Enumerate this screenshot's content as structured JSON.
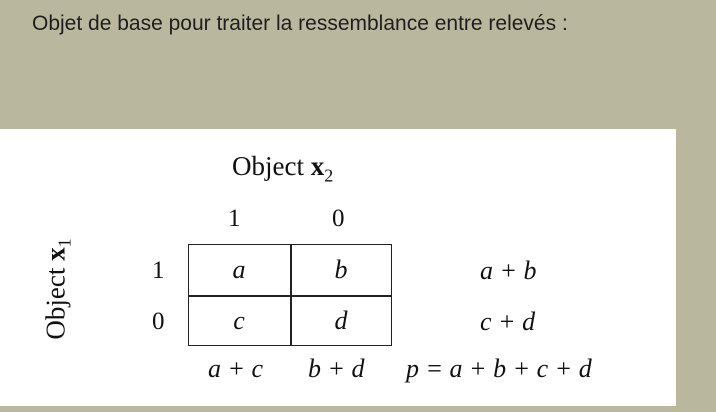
{
  "heading": "Objet de base pour traiter la ressemblance entre relevés :",
  "table": {
    "col_object": "Object ",
    "col_var": "x",
    "col_sub": "2",
    "row_object": "Object ",
    "row_var": "x",
    "row_sub": "1",
    "col_labels": [
      "1",
      "0"
    ],
    "row_labels": [
      "1",
      "0"
    ],
    "cells": [
      "a",
      "b",
      "c",
      "d"
    ],
    "row_totals": [
      "a + b",
      "c + d"
    ],
    "col_totals": [
      "a + c",
      "b + d"
    ],
    "grand_total": "p = a + b + c + d"
  }
}
